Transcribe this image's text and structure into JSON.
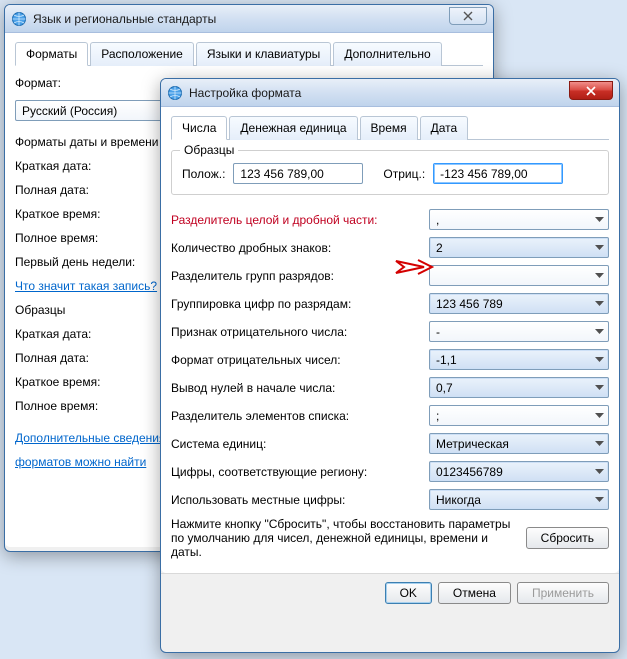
{
  "back": {
    "title": "Язык и региональные стандарты",
    "tabs": [
      "Форматы",
      "Расположение",
      "Языки и клавиатуры",
      "Дополнительно"
    ],
    "format_label": "Формат:",
    "format_value": "Русский (Россия)",
    "section": "Форматы даты и времени",
    "short_date": "Краткая дата:",
    "long_date": "Полная дата:",
    "short_time": "Краткое время:",
    "long_time": "Полное время:",
    "first_day": "Первый день недели:",
    "what_link": "Что значит такая запись?",
    "samples": "Образцы",
    "s_short_date": "Краткая дата:",
    "s_long_date": "Полная дата:",
    "s_short_time": "Краткое время:",
    "s_long_time": "Полное время:",
    "more_link1": "Дополнительные сведения",
    "more_link2": "форматов можно найти"
  },
  "front": {
    "title": "Настройка формата",
    "tabs": [
      "Числа",
      "Денежная единица",
      "Время",
      "Дата"
    ],
    "samples_legend": "Образцы",
    "pos_label": "Полож.:",
    "pos_value": "123 456 789,00",
    "neg_label": "Отриц.:",
    "neg_value": "-123 456 789,00",
    "rows": {
      "decimal_sep": "Разделитель целой и дробной части:",
      "decimal_sep_val": ",",
      "decimal_digits": "Количество дробных знаков:",
      "decimal_digits_val": "2",
      "group_sep": "Разделитель групп разрядов:",
      "group_sep_val": "",
      "grouping": "Группировка цифр по разрядам:",
      "grouping_val": "123 456 789",
      "neg_sign": "Признак отрицательного числа:",
      "neg_sign_val": "-",
      "neg_format": "Формат отрицательных чисел:",
      "neg_format_val": "-1,1",
      "leading_zero": "Вывод нулей в начале числа:",
      "leading_zero_val": "0,7",
      "list_sep": "Разделитель элементов списка:",
      "list_sep_val": ";",
      "measure": "Система единиц:",
      "measure_val": "Метрическая",
      "native_digits": "Цифры, соответствующие региону:",
      "native_digits_val": "0123456789",
      "digit_subst": "Использовать местные цифры:",
      "digit_subst_val": "Никогда"
    },
    "reset_text": "Нажмите кнопку \"Сбросить\", чтобы восстановить параметры по умолчанию для чисел, денежной единицы, времени и даты.",
    "reset_btn": "Сбросить",
    "ok": "OK",
    "cancel": "Отмена",
    "apply": "Применить"
  }
}
